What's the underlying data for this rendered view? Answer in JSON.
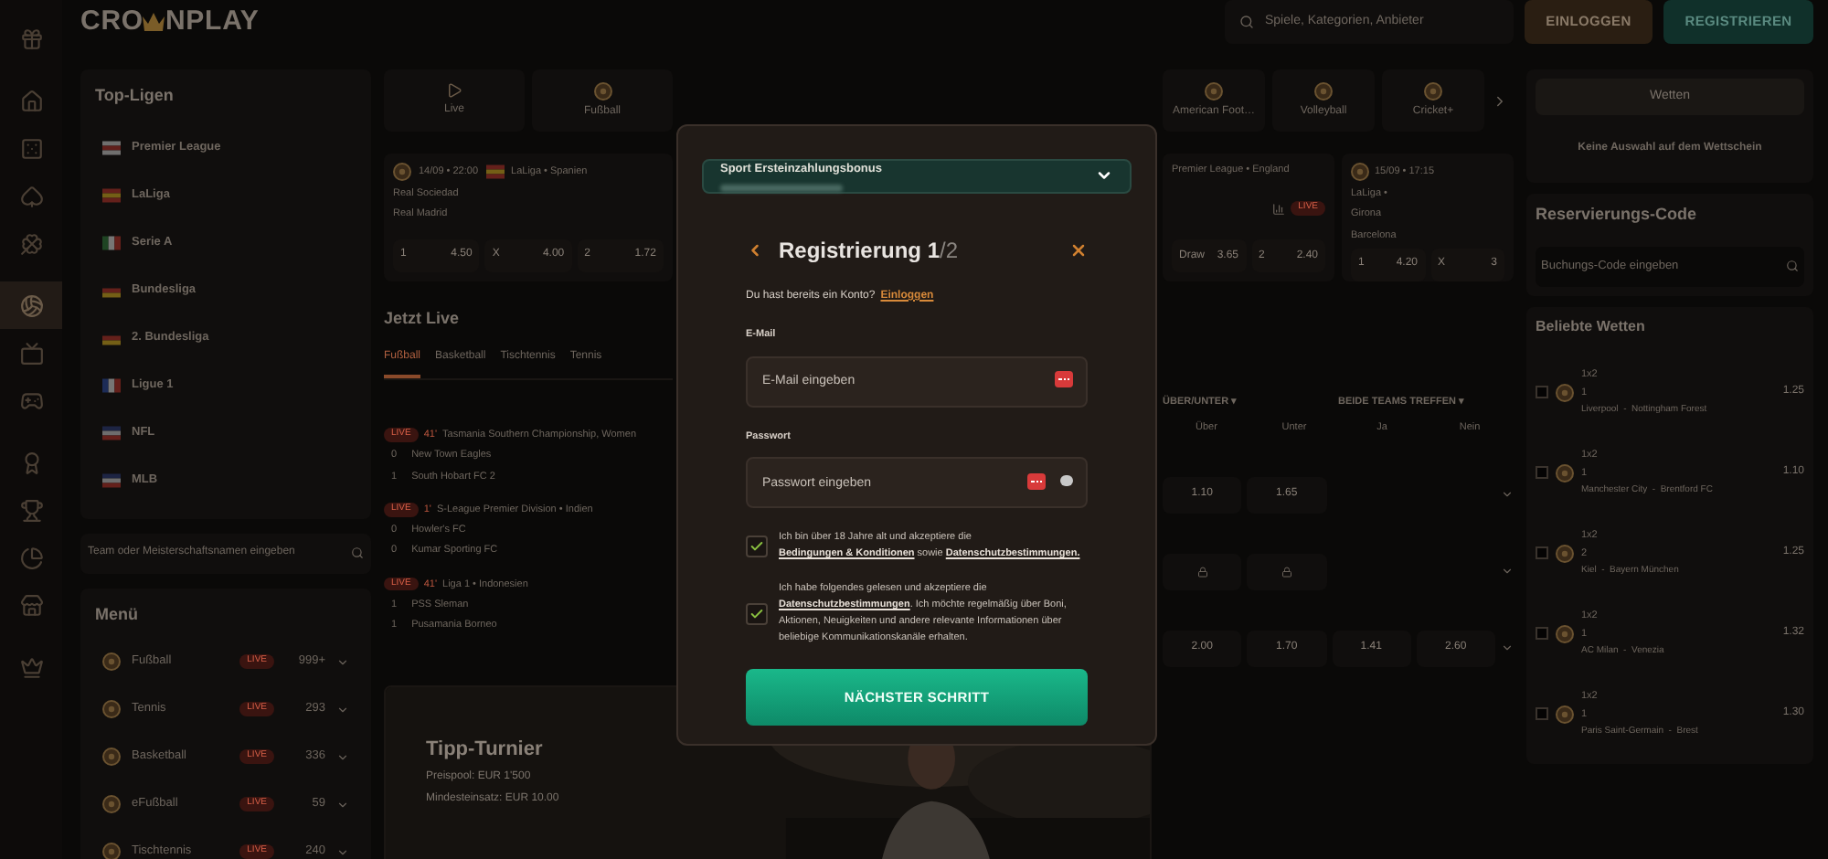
{
  "header": {
    "logo_parts": [
      "CRO",
      "NPLAY"
    ],
    "search": {
      "placeholder": "Spiele, Kategorien, Anbieter"
    },
    "buttons": [
      {
        "label": "EINLOGGEN",
        "kind": "login"
      },
      {
        "label": "REGISTRIEREN",
        "kind": "register"
      }
    ]
  },
  "rail": [
    {
      "selected": false
    },
    {
      "selected": false
    },
    {
      "selected": false
    },
    {
      "selected": false
    },
    {
      "selected": false
    },
    {
      "selected": true
    },
    {
      "selected": false
    },
    {
      "selected": false
    },
    {
      "selected": false
    },
    {
      "selected": false
    },
    {
      "selected": false
    },
    {
      "selected": false
    },
    {
      "selected": false
    }
  ],
  "top_leagues": {
    "title": "Top-Ligen",
    "items": [
      "Premier League",
      "LaLiga",
      "Serie A",
      "Bundesliga",
      "2. Bundesliga",
      "Ligue 1",
      "NFL",
      "MLB"
    ]
  },
  "team_search": {
    "placeholder": "Team oder Meisterschaftsnamen eingeben"
  },
  "menu": {
    "title": "Menü",
    "items": [
      {
        "name": "Fußball",
        "badge": "LIVE",
        "count": "999+"
      },
      {
        "name": "Tennis",
        "badge": "LIVE",
        "count": "293"
      },
      {
        "name": "Basketball",
        "badge": "LIVE",
        "count": "336"
      },
      {
        "name": "eFußball",
        "badge": "LIVE",
        "count": "59"
      },
      {
        "name": "Tischtennis",
        "badge": "LIVE",
        "count": "240"
      }
    ]
  },
  "sport_tabs_left": [
    "Live",
    "Fußball"
  ],
  "sport_tabs_right": [
    "American Foot…",
    "Volleyball",
    "Cricket+"
  ],
  "match_left": {
    "time": "14/09 • 22:00",
    "league": "LaLiga • Spanien",
    "teams": [
      "Real Sociedad",
      "Real Madrid"
    ],
    "odds": [
      {
        "pick": "1",
        "price": "4.50"
      },
      {
        "pick": "X",
        "price": "4.00"
      },
      {
        "pick": "2",
        "price": "1.72"
      }
    ]
  },
  "match_mid": {
    "league": "Premier League • England",
    "badge": "LIVE",
    "odds": [
      {
        "pick": "Draw",
        "price": "3.65"
      },
      {
        "pick": "2",
        "price": "2.40"
      }
    ]
  },
  "match_right": {
    "time": "15/09 • 17:15",
    "league": "LaLiga •",
    "teams": [
      "Girona",
      "Barcelona"
    ],
    "odds": [
      {
        "pick": "1",
        "price": "4.20"
      },
      {
        "pick": "X",
        "price": "3"
      }
    ]
  },
  "live": {
    "title": "Jetzt Live",
    "tabs": [
      {
        "label": "Fußball",
        "selected": true
      },
      {
        "label": "Basketball",
        "selected": false
      },
      {
        "label": "Tischtennis",
        "selected": false
      },
      {
        "label": "Tennis",
        "selected": false
      }
    ],
    "matches": [
      {
        "badge": "LIVE",
        "minute": "41'",
        "league": "Tasmania Southern Championship, Women",
        "teams": [
          {
            "score": "0",
            "name": "New Town Eagles"
          },
          {
            "score": "1",
            "name": "South Hobart FC 2"
          }
        ]
      },
      {
        "badge": "LIVE",
        "minute": "1'",
        "league": "S-League Premier Division • Indien",
        "teams": [
          {
            "score": "0",
            "name": "Howler's FC"
          },
          {
            "score": "0",
            "name": "Kumar Sporting FC"
          }
        ]
      },
      {
        "badge": "LIVE",
        "minute": "41'",
        "league": "Liga 1 • Indonesien",
        "teams": [
          {
            "score": "1",
            "name": "PSS Sleman"
          },
          {
            "score": "1",
            "name": "Pusamania Borneo"
          }
        ]
      }
    ]
  },
  "odds_table": {
    "groups": [
      "ÜBER/UNTER ▾",
      "BEIDE TEAMS TREFFEN ▾"
    ],
    "columns": [
      "Über",
      "Unter",
      "Ja",
      "Nein"
    ],
    "rows": [
      {
        "locked": false,
        "cells": [
          "1.10",
          "1.65"
        ]
      },
      {
        "locked": true,
        "cells": []
      },
      {
        "locked": false,
        "cells": [
          "2.00",
          "1.70",
          "1.41",
          "2.60"
        ]
      }
    ]
  },
  "banner": {
    "title": "Tipp-Turnier",
    "lines": [
      "Preispool: EUR 1'500",
      "Mindesteinsatz: EUR 10.00"
    ]
  },
  "betslip": {
    "button": "Wetten",
    "empty": "Keine Auswahl auf dem Wettschein"
  },
  "booking": {
    "title": "Reservierungs-Code",
    "placeholder": "Buchungs-Code eingeben"
  },
  "popular": {
    "title": "Beliebte Wetten",
    "items": [
      {
        "checked": false,
        "market": "1x2",
        "pick": "1",
        "match": "Liverpool  -  Nottingham Forest",
        "price": "1.25"
      },
      {
        "checked": false,
        "market": "1x2",
        "pick": "1",
        "match": "Manchester City  -  Brentford FC",
        "price": "1.10"
      },
      {
        "checked": false,
        "market": "1x2",
        "pick": "2",
        "match": "Kiel  -  Bayern München",
        "price": "1.25"
      },
      {
        "checked": false,
        "market": "1x2",
        "pick": "1",
        "match": "AC Milan  -  Venezia",
        "price": "1.32"
      },
      {
        "checked": false,
        "market": "1x2",
        "pick": "1",
        "match": "Paris Saint-Germain  -  Brest",
        "price": "1.30"
      }
    ]
  },
  "modal": {
    "bonus": {
      "title": "Sport Ersteinzahlungsbonus",
      "expanded": false
    },
    "title_main": "Registrierung 1",
    "title_rest": "/2",
    "account_text": "Du hast bereits ein Konto?",
    "account_link": "Einloggen",
    "fields": [
      {
        "label": "E-Mail",
        "placeholder": "E-Mail eingeben",
        "kind": "email"
      },
      {
        "label": "Passwort",
        "placeholder": "Passwort eingeben",
        "kind": "password"
      }
    ],
    "consents": [
      {
        "checked": true,
        "parts": [
          {
            "text": "Ich bin über 18 Jahre alt und akzeptiere die "
          },
          {
            "link": "Bedingungen & Konditionen"
          },
          {
            "text": " sowie "
          },
          {
            "link": "Datenschutzbestimmungen."
          }
        ]
      },
      {
        "checked": true,
        "parts": [
          {
            "text": "Ich habe folgendes gelesen und akzeptiere die "
          },
          {
            "link": "Datenschutzbestimmungen"
          },
          {
            "text": ". Ich möchte regelmäßig über Boni, Aktionen, Neuigkeiten und andere relevante Informationen über beliebige Kommunikationskanäle erhalten."
          }
        ]
      }
    ],
    "submit": "NÄCHSTER SCHRITT"
  }
}
